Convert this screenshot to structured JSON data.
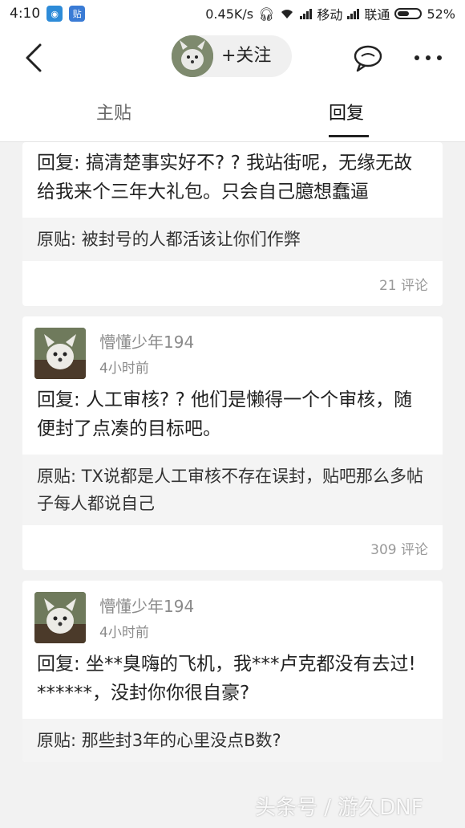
{
  "status_bar": {
    "time": "4:10",
    "badge_tie": "贴",
    "network_speed": "0.45K/s",
    "carrier1": "移动",
    "carrier2": "联通",
    "battery": "52%",
    "battery_level": 0.52
  },
  "header": {
    "follow_label": "+关注"
  },
  "tabs": [
    {
      "label": "主贴",
      "active": false
    },
    {
      "label": "回复",
      "active": true
    }
  ],
  "posts": [
    {
      "reply": "回复: 搞清楚事实好不? ? 我站街呢，无缘无故给我来个三年大礼包。只会自己臆想蠢逼",
      "original": "原贴: 被封号的人都活该让你们作弊",
      "comments": "21 评论"
    },
    {
      "username": "懵懂少年194",
      "time": "4小时前",
      "reply": "回复: 人工审核? ? 他们是懒得一个个审核，随便封了点凑的目标吧。",
      "original": "原贴: TX说都是人工审核不存在误封，贴吧那么多帖子每人都说自己",
      "comments": "309 评论"
    },
    {
      "username": "懵懂少年194",
      "time": "4小时前",
      "reply": "回复: 坐**臭嗨的飞机，我***卢克都没有去过! ******，没封你你很自豪?",
      "original": "原贴: 那些封3年的心里没点B数?"
    }
  ],
  "watermark": "头条号 / 游久DNF"
}
